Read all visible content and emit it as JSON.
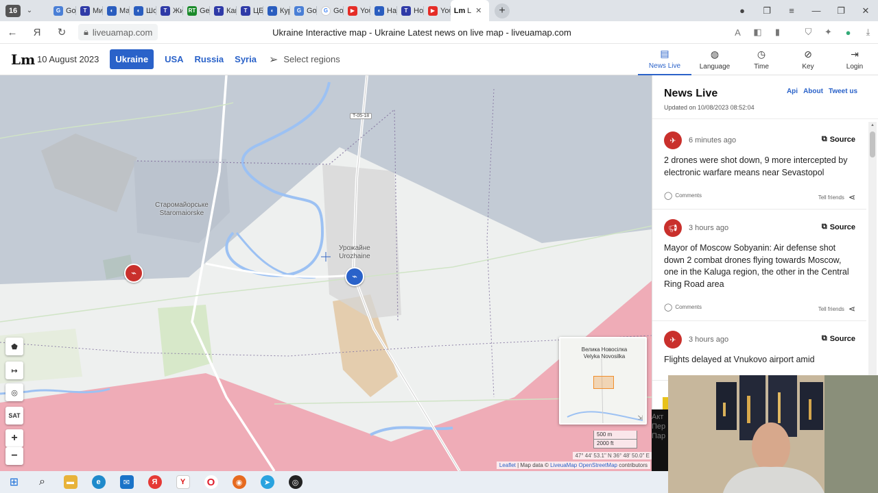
{
  "browser": {
    "tab_count": "16",
    "tabs": [
      {
        "label": "Goo",
        "color": "#4a7fd6",
        "glyph": "G"
      },
      {
        "label": "Ми",
        "color": "#2f3aa7",
        "glyph": "T"
      },
      {
        "label": "Ма",
        "color": "#2a5dbf",
        "glyph": "◐"
      },
      {
        "label": "Шо",
        "color": "#2a5dbf",
        "glyph": "◐"
      },
      {
        "label": "Жи",
        "color": "#2f3aa7",
        "glyph": "T"
      },
      {
        "label": "Ger",
        "color": "#1a8a2a",
        "glyph": "RT"
      },
      {
        "label": "Кан",
        "color": "#2f3aa7",
        "glyph": "T"
      },
      {
        "label": "ЦБ",
        "color": "#2f3aa7",
        "glyph": "T"
      },
      {
        "label": "Кур",
        "color": "#2a5dbf",
        "glyph": "◐"
      },
      {
        "label": "Goo",
        "color": "#4a7fd6",
        "glyph": "G"
      },
      {
        "label": "Goo",
        "color": "#ffffff",
        "glyph": "G"
      },
      {
        "label": "You",
        "color": "#e52d27",
        "glyph": "▶"
      },
      {
        "label": "Над",
        "color": "#2a5dbf",
        "glyph": "◐"
      },
      {
        "label": "Нов",
        "color": "#2f3aa7",
        "glyph": "T"
      },
      {
        "label": "You",
        "color": "#e52d27",
        "glyph": "▶"
      }
    ],
    "active_tab_label": "L",
    "url": "liveuamap.com",
    "page_title": "Ukraine Interactive map - Ukraine Latest news on live map - liveuamap.com"
  },
  "header": {
    "date": "10 August 2023",
    "regions": [
      "Ukraine",
      "USA",
      "Russia",
      "Syria"
    ],
    "active_region": "Ukraine",
    "select_regions": "Select regions",
    "menu": [
      {
        "label": "News Live",
        "icon": "▤",
        "active": true
      },
      {
        "label": "Language",
        "icon": "◍",
        "active": false
      },
      {
        "label": "Time",
        "icon": "◷",
        "active": false
      },
      {
        "label": "Key",
        "icon": "⊘",
        "active": false
      },
      {
        "label": "Login",
        "icon": "⇥",
        "active": false
      }
    ]
  },
  "map": {
    "places": [
      {
        "line1": "Старомайорське",
        "line2": "Staromaiorske"
      },
      {
        "line1": "Урожайне",
        "line2": "Urozhaine"
      }
    ],
    "road_badge": "T-05-18",
    "controls": {
      "polygon": "⬟",
      "measure": "↦",
      "hide": "◎",
      "sat": "SAT",
      "zoom_in": "+",
      "zoom_out": "−"
    },
    "minimap": {
      "line1": "Велика Новосілка",
      "line2": "Velyka Novosilka"
    },
    "scale_m": "500 m",
    "scale_ft": "2000 ft",
    "coords": "47° 44' 53.1\" N 36° 48' 50.0\" E",
    "attribution": {
      "leaflet": "Leaflet",
      "sep": " | Map data © ",
      "liveuamap": "LiveuaMap",
      "osm": "OpenStreetMap",
      "contributors": " contributors"
    },
    "colors": {
      "occupied": "#b9c0ce",
      "contested": "#ef9aa5",
      "highlight": "#f3f4f5"
    }
  },
  "news": {
    "title": "News Live",
    "updated": "Updated on 10/08/2023 08:52:04",
    "links": [
      "Api",
      "About",
      "Tweet us"
    ],
    "source_label": "Source",
    "comments_label": "Comments",
    "tell_label": "Tell friends",
    "items": [
      {
        "time": "6 minutes ago",
        "icon": "drone",
        "text": "2 drones were shot down, 9 more intercepted by electronic warfare means near Sevastopol"
      },
      {
        "time": "3 hours ago",
        "icon": "loudspeaker",
        "text": "Mayor of Moscow Sobyanin: Air defense shot down 2 combat drones flying towards Moscow, one in the Kaluga region, the other in the Central Ring Road area"
      },
      {
        "time": "3 hours ago",
        "icon": "airplane",
        "text": "Flights delayed at Vnukovo airport amid"
      }
    ]
  },
  "overlay": {
    "partial_text": "Акт\nПер\nПар"
  }
}
